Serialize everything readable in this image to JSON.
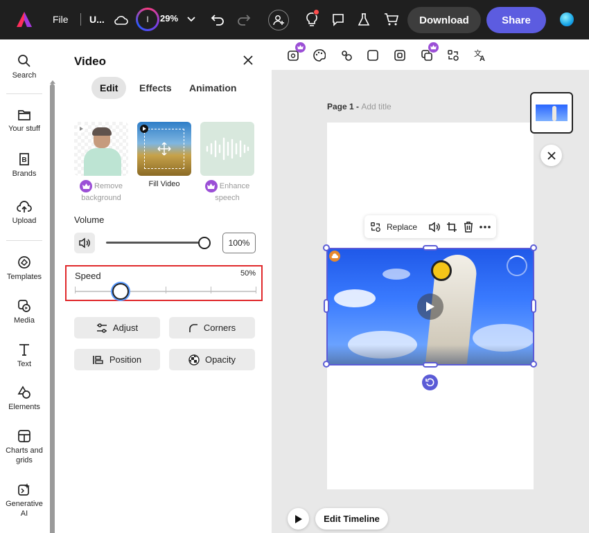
{
  "topbar": {
    "file_label": "File",
    "doc_title": "U...",
    "avatar_letter": "I",
    "zoom": "29%",
    "download_label": "Download",
    "share_label": "Share"
  },
  "rail": {
    "items": [
      {
        "label": "Search",
        "icon": "search-icon"
      },
      {
        "label": "Your stuff",
        "icon": "folder-icon"
      },
      {
        "label": "Brands",
        "icon": "brand-icon"
      },
      {
        "label": "Upload",
        "icon": "upload-icon"
      },
      {
        "label": "Templates",
        "icon": "templates-icon"
      },
      {
        "label": "Media",
        "icon": "media-icon"
      },
      {
        "label": "Text",
        "icon": "text-icon"
      },
      {
        "label": "Elements",
        "icon": "elements-icon"
      },
      {
        "label": "Charts and grids",
        "icon": "charts-icon"
      },
      {
        "label": "Generative AI",
        "icon": "genai-icon"
      }
    ]
  },
  "panel": {
    "title": "Video",
    "tabs": [
      "Edit",
      "Effects",
      "Animation"
    ],
    "active_tab": "Edit",
    "tiles": [
      {
        "label": "Remove background",
        "premium": true
      },
      {
        "label": "Fill Video",
        "premium": false
      },
      {
        "label": "Enhance speech",
        "premium": true
      }
    ],
    "volume": {
      "label": "Volume",
      "value": "100%"
    },
    "speed": {
      "label": "Speed",
      "value": "50%"
    },
    "buttons": {
      "adjust": "Adjust",
      "corners": "Corners",
      "position": "Position",
      "opacity": "Opacity"
    }
  },
  "canvas": {
    "page_label": "Page 1 - ",
    "add_title": "Add title",
    "context_replace": "Replace",
    "edit_timeline": "Edit Timeline"
  },
  "colors": {
    "accent": "#5c5ce0",
    "selection": "#5b5bd6",
    "highlight_box": "#e0282b",
    "premium": "#9b4fd6"
  }
}
